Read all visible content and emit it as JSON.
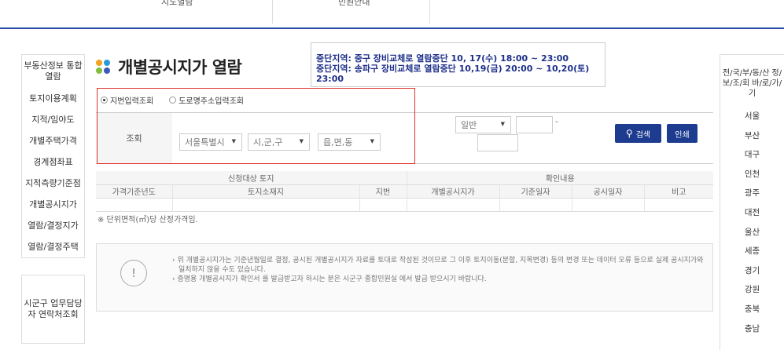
{
  "topnav": {
    "tab1": "지도열람",
    "tab2": "민원안내"
  },
  "leftnav": {
    "items": [
      "부동산정보 통합 열람",
      "토지이용계획",
      "지적/임야도",
      "개별주택가격",
      "경계점좌표",
      "지적측량기준점",
      "개별공시지가",
      "열람/결정지가",
      "열람/결정주택"
    ],
    "contact": "시군구 업무담당자 연락처조회"
  },
  "page": {
    "title": "개별공시지가 열람"
  },
  "notice": {
    "line1": "중단지역: 중구 장비교체로 열람중단 10, 17(수) 18:00 ~ 23:00",
    "line2": "중단지역: 송파구 장비교체로 열람중단 10,19(금) 20:00 ~ 10,20(토) 23:00"
  },
  "search": {
    "radio1": "지번입력조회",
    "radio2": "도로명주소입력조회",
    "label": "조회",
    "sido": "서울특별시",
    "sigungu": "시,군,구",
    "eupmyeondong": "읍,면,동",
    "type": "일반",
    "dash": "-",
    "search_button": "검색",
    "print_button": "인쇄"
  },
  "table": {
    "group1": "신청대상 토지",
    "group2": "확인내용",
    "columns": [
      "가격기준년도",
      "토지소재지",
      "지번",
      "개별공시지가",
      "기준일자",
      "공시일자",
      "비고"
    ]
  },
  "unit_note": "※ 단위면적(㎡)당 산정가격임.",
  "info": {
    "line1": "› 위 개별공시지가는 기준년월일로 결정, 공시된 개별공시지가 자료를 토대로 작성된 것이므로 그 이후 토지이동(분할, 지목변경) 등의 변경 또는 데이터 오류 등으로 실제 공시지가와",
    "line2": "일치하지 않을 수도 있습니다.",
    "line3": "› 증명용 개별공시지가 확인서 를 발급받고자 하시는 분은 시군구 종합민원실 에서 발급 받으시기 바랍니다.",
    "icon": "!"
  },
  "rightnav": {
    "header": "전/국/부/동/산 정/보/조/회 바/로/가/기",
    "cities": [
      "서울",
      "부산",
      "대구",
      "인천",
      "광주",
      "대전",
      "울산",
      "세종",
      "경기",
      "강원",
      "충북",
      "충남"
    ]
  },
  "colors": {
    "accent": "#1d3c8f",
    "highlight": "#e0332b",
    "dot1": "#f4a21b",
    "dot2": "#2b9bd8",
    "dot3": "#7fbf3f",
    "dot4": "#3a59b8"
  }
}
